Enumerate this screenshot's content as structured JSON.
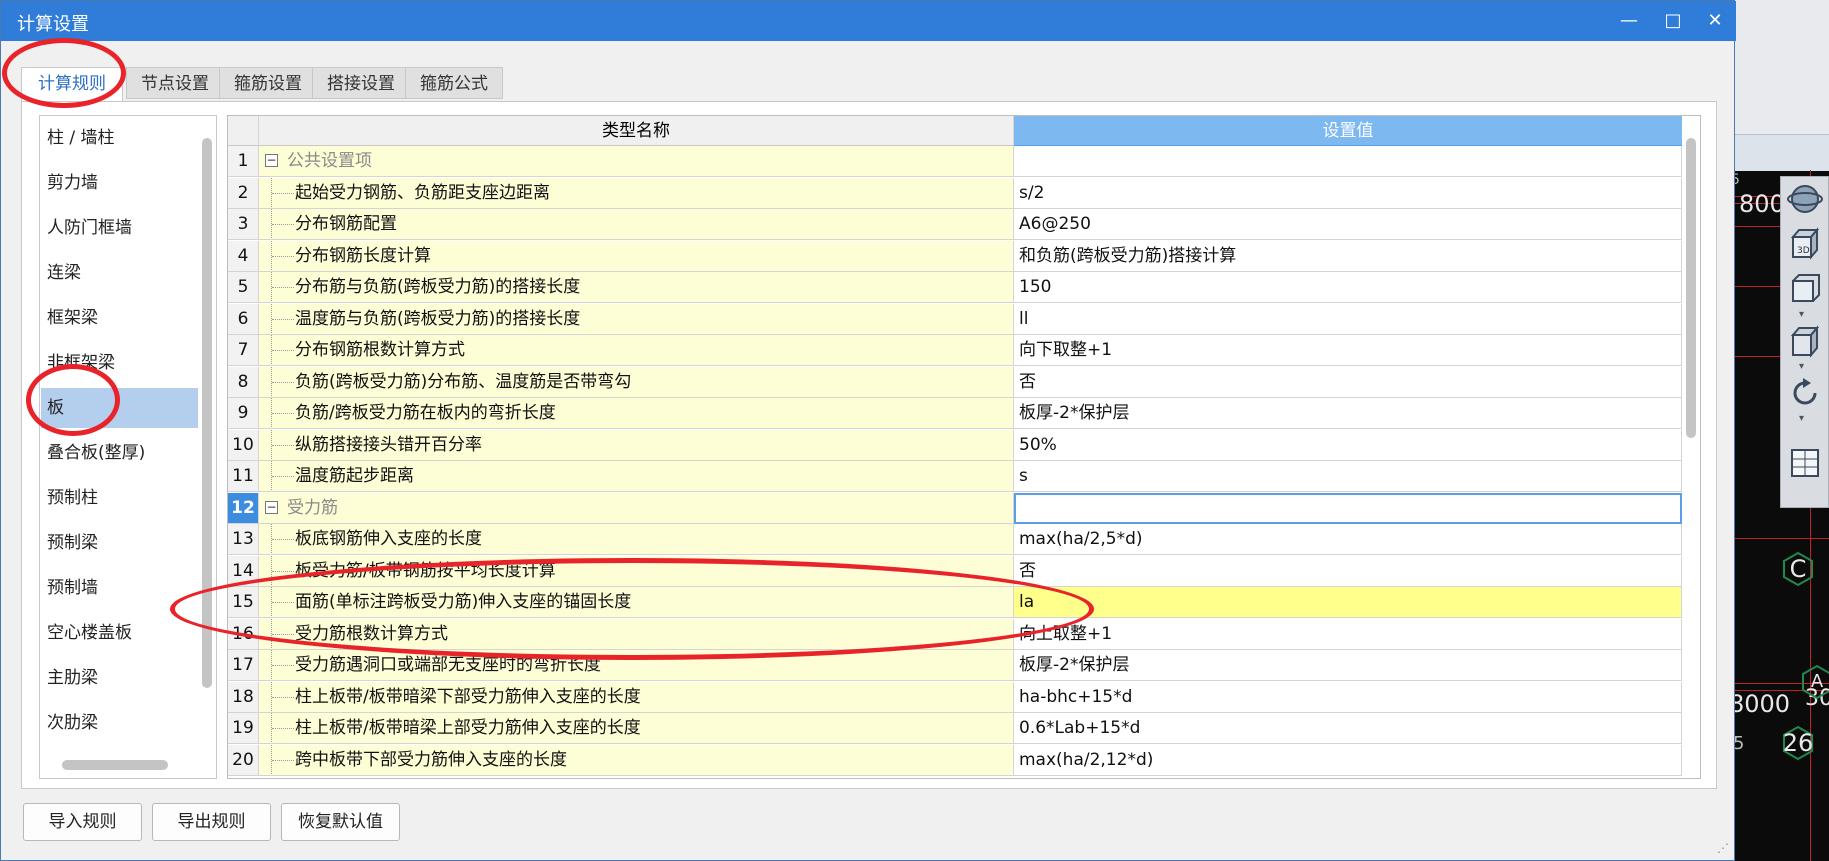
{
  "window": {
    "title": "计算设置"
  },
  "tabs": [
    {
      "label": "计算规则",
      "active": true
    },
    {
      "label": "节点设置",
      "active": false
    },
    {
      "label": "箍筋设置",
      "active": false
    },
    {
      "label": "搭接设置",
      "active": false
    },
    {
      "label": "箍筋公式",
      "active": false
    }
  ],
  "categories": [
    "柱 / 墙柱",
    "剪力墙",
    "人防门框墙",
    "连梁",
    "框架梁",
    "非框架梁",
    "板",
    "叠合板(整厚)",
    "预制柱",
    "预制梁",
    "预制墙",
    "空心楼盖板",
    "主肋梁",
    "次肋梁"
  ],
  "selected_category": "板",
  "grid": {
    "columns": {
      "name": "类型名称",
      "value": "设置值"
    },
    "rows": [
      {
        "num": "1",
        "name": "公共设置项",
        "value": "",
        "group": true
      },
      {
        "num": "2",
        "name": "起始受力钢筋、负筋距支座边距离",
        "value": "s/2"
      },
      {
        "num": "3",
        "name": "分布钢筋配置",
        "value": "A6@250"
      },
      {
        "num": "4",
        "name": "分布钢筋长度计算",
        "value": "和负筋(跨板受力筋)搭接计算"
      },
      {
        "num": "5",
        "name": "分布筋与负筋(跨板受力筋)的搭接长度",
        "value": "150"
      },
      {
        "num": "6",
        "name": "温度筋与负筋(跨板受力筋)的搭接长度",
        "value": "ll"
      },
      {
        "num": "7",
        "name": "分布钢筋根数计算方式",
        "value": "向下取整+1"
      },
      {
        "num": "8",
        "name": "负筋(跨板受力筋)分布筋、温度筋是否带弯勾",
        "value": "否"
      },
      {
        "num": "9",
        "name": "负筋/跨板受力筋在板内的弯折长度",
        "value": "板厚-2*保护层"
      },
      {
        "num": "10",
        "name": "纵筋搭接接头错开百分率",
        "value": "50%"
      },
      {
        "num": "11",
        "name": "温度筋起步距离",
        "value": "s"
      },
      {
        "num": "12",
        "name": "受力筋",
        "value": "",
        "group": true,
        "selected": true
      },
      {
        "num": "13",
        "name": "板底钢筋伸入支座的长度",
        "value": "max(ha/2,5*d)"
      },
      {
        "num": "14",
        "name": "板受力筋/板带钢筋按平均长度计算",
        "value": "否"
      },
      {
        "num": "15",
        "name": "面筋(单标注跨板受力筋)伸入支座的锚固长度",
        "value": "la",
        "highlight": true
      },
      {
        "num": "16",
        "name": "受力筋根数计算方式",
        "value": "向上取整+1"
      },
      {
        "num": "17",
        "name": "受力筋遇洞口或端部无支座时的弯折长度",
        "value": "板厚-2*保护层"
      },
      {
        "num": "18",
        "name": "柱上板带/板带暗梁下部受力筋伸入支座的长度",
        "value": "ha-bhc+15*d"
      },
      {
        "num": "19",
        "name": "柱上板带/板带暗梁上部受力筋伸入支座的长度",
        "value": "0.6*Lab+15*d"
      },
      {
        "num": "20",
        "name": "跨中板带下部受力筋伸入支座的长度",
        "value": "max(ha/2,12*d)"
      }
    ]
  },
  "buttons": {
    "import": "导入规则",
    "export": "导出规则",
    "reset": "恢复默认值"
  },
  "window_controls": {
    "minimize": "—",
    "maximize": "□",
    "close": "✕"
  },
  "background_cad": {
    "labels": [
      "800",
      "3D",
      "8000",
      "30",
      "26",
      "C",
      "A",
      "5",
      "5"
    ]
  },
  "colors": {
    "titlebar": "#2f7dd8",
    "accent": "#2d6fc4",
    "header_value": "#7db8f0",
    "highlight": "#ffff8c",
    "annotation": "#e8232a"
  }
}
